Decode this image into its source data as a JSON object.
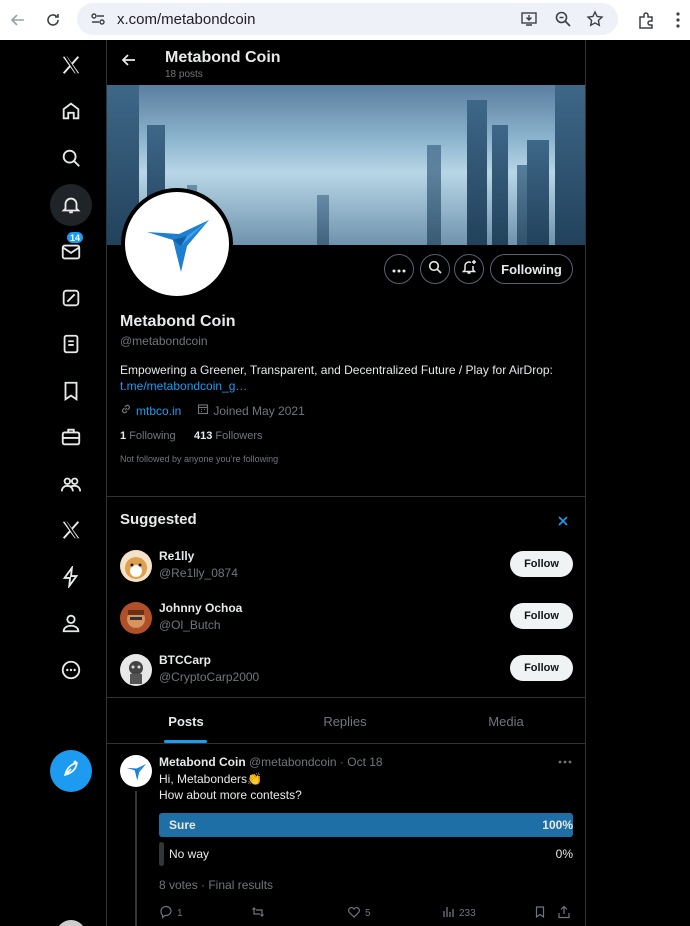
{
  "browser": {
    "url": "x.com/metabondcoin"
  },
  "colors": {
    "accent": "#1d9bf0",
    "background": "#000000",
    "poll_winner": "#1d6fa5"
  },
  "nav": {
    "items": [
      "x-logo-icon",
      "home-icon",
      "explore-icon",
      "notifications-icon",
      "messages-icon",
      "grok-icon",
      "lists-icon",
      "bookmarks-icon",
      "jobs-icon",
      "communities-icon",
      "premium-icon",
      "verified-orgs-icon",
      "profile-icon",
      "more-icon"
    ],
    "notifications_badge": "14",
    "compose_icon": "compose-feather-icon"
  },
  "header": {
    "title": "Metabond Coin",
    "posts_count": "18 posts"
  },
  "profile": {
    "name": "Metabond Coin",
    "handle": "@metabondcoin",
    "bio": "Empowering a Greener, Transparent, and Decentralized Future  / Play for AirDrop:",
    "bio_link": "t.me/metabondcoin_g…",
    "website": "mtbco.in",
    "joined": "Joined May 2021",
    "following_count": "1",
    "following_label": "Following",
    "followers_count": "413",
    "followers_label": "Followers",
    "not_followed_note": "Not followed by anyone you’re following",
    "following_button": "Following"
  },
  "suggested": {
    "title": "Suggested",
    "items": [
      {
        "name": "Re1lly",
        "handle": "@Re1lly_0874",
        "button": "Follow"
      },
      {
        "name": "Johnny Ochoa",
        "handle": "@Ol_Butch",
        "button": "Follow"
      },
      {
        "name": "BTCCarp",
        "handle": "@CryptoCarp2000",
        "button": "Follow"
      }
    ]
  },
  "tabs": [
    {
      "label": "Posts",
      "active": true
    },
    {
      "label": "Replies",
      "active": false
    },
    {
      "label": "Media",
      "active": false
    }
  ],
  "post": {
    "author": "Metabond Coin",
    "handle_date": "@metabondcoin · Oct 18",
    "line1": "Hi, Metabonders👏",
    "line2": "How about more contests?",
    "poll": [
      {
        "label": "Sure",
        "percent_text": "100%",
        "percent": 100
      },
      {
        "label": "No way",
        "percent_text": "0%",
        "percent": 0
      }
    ],
    "poll_summary": "8 votes · Final results",
    "replies": "1",
    "reposts": "",
    "likes": "5",
    "views": "233"
  }
}
